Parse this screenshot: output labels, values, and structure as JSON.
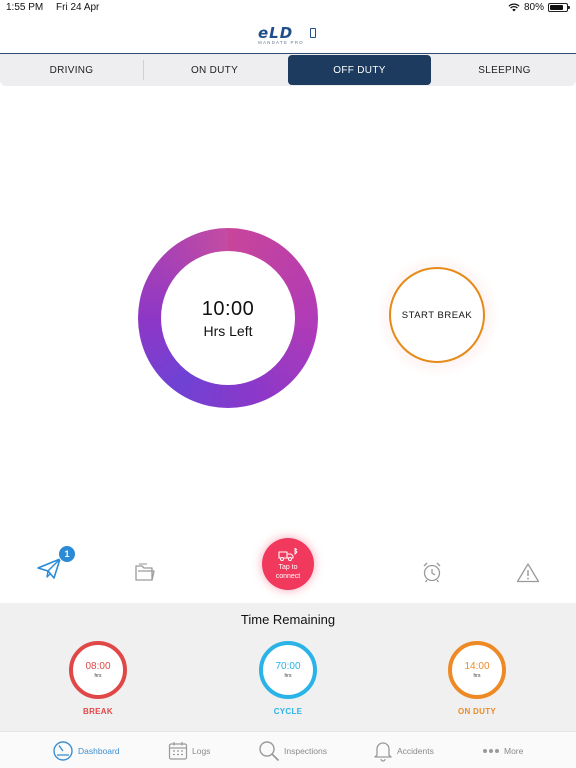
{
  "status_bar": {
    "time": "1:55 PM",
    "date": "Fri 24 Apr",
    "battery": "80%",
    "battery_level": 0.8
  },
  "header": {
    "logo_text": "eLD",
    "logo_subtitle": "MANDATE PRO"
  },
  "duty_tabs": [
    {
      "label": "DRIVING",
      "active": false
    },
    {
      "label": "ON DUTY",
      "active": false
    },
    {
      "label": "OFF DUTY",
      "active": true
    },
    {
      "label": "SLEEPING",
      "active": false
    }
  ],
  "timer": {
    "time": "10:00",
    "label": "Hrs Left"
  },
  "start_break": {
    "label": "START  BREAK",
    "color": "#e68a17"
  },
  "icon_row": {
    "messages_badge": "1",
    "connect_label_line1": "Tap to",
    "connect_label_line2": "connect",
    "icons": [
      "send-icon",
      "documents-icon",
      "truck-bluetooth-icon",
      "alarm-clock-icon",
      "warning-icon"
    ]
  },
  "time_remaining": {
    "title": "Time Remaining",
    "gauges": [
      {
        "value": "08:00",
        "unit": "hrs",
        "label": "BREAK",
        "color": "#e04848"
      },
      {
        "value": "70:00",
        "unit": "hrs",
        "label": "CYCLE",
        "color": "#2ab3e6"
      },
      {
        "value": "14:00",
        "unit": "hrs",
        "label": "ON DUTY",
        "color": "#ee8a25"
      }
    ]
  },
  "bottom_nav": [
    {
      "label": "Dashboard",
      "icon": "dashboard-gauge-icon",
      "active": true
    },
    {
      "label": "Logs",
      "icon": "calendar-icon",
      "active": false
    },
    {
      "label": "Inspections",
      "icon": "search-icon",
      "active": false
    },
    {
      "label": "Accidents",
      "icon": "bell-icon",
      "active": false
    },
    {
      "label": "More",
      "icon": "more-dots-icon",
      "active": false
    }
  ]
}
